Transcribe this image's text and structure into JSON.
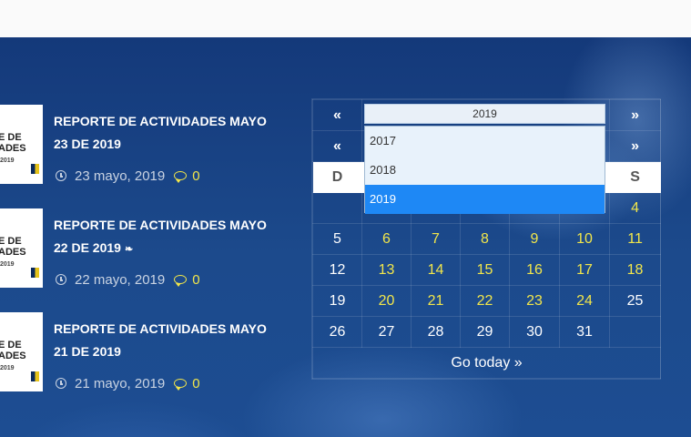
{
  "posts": [
    {
      "title_line1": "REPORTE DE ACTIVIDADES MAYO",
      "title_line2": "23 DE 2019",
      "date": "23 mayo, 2019",
      "comments": "0",
      "thumb_line1": "E DE",
      "thumb_line2": "ADES",
      "thumb_year": "2019"
    },
    {
      "title_line1": "REPORTE DE ACTIVIDADES MAYO",
      "title_line2": "22 DE 2019",
      "date": "22 mayo, 2019",
      "comments": "0",
      "thumb_line1": "E DE",
      "thumb_line2": "ADES",
      "thumb_year": "2019"
    },
    {
      "title_line1": "REPORTE DE ACTIVIDADES MAYO",
      "title_line2": "21 DE 2019",
      "date": "21 mayo, 2019",
      "comments": "0",
      "thumb_line1": "E DE",
      "thumb_line2": "ADES",
      "thumb_year": "2019"
    }
  ],
  "calendar": {
    "prev_year": "«",
    "next_year": "»",
    "prev_month": "«",
    "next_month": "»",
    "year_value": "2019",
    "year_options": [
      "2017",
      "2018",
      "2019"
    ],
    "selected_year": "2019",
    "weekday_first": "D",
    "weekday_last": "S",
    "weeks": [
      [
        "",
        "",
        "",
        "",
        "",
        "",
        "4"
      ],
      [
        "5",
        "6",
        "7",
        "8",
        "9",
        "10",
        "11"
      ],
      [
        "12",
        "13",
        "14",
        "15",
        "16",
        "17",
        "18"
      ],
      [
        "19",
        "20",
        "21",
        "22",
        "23",
        "24",
        "25"
      ],
      [
        "26",
        "27",
        "28",
        "29",
        "30",
        "31",
        ""
      ]
    ],
    "go_today": "Go today »"
  },
  "colors": {
    "accent": "#f2e64a",
    "band": "#1c4a8c",
    "selected": "#1e88f5"
  }
}
